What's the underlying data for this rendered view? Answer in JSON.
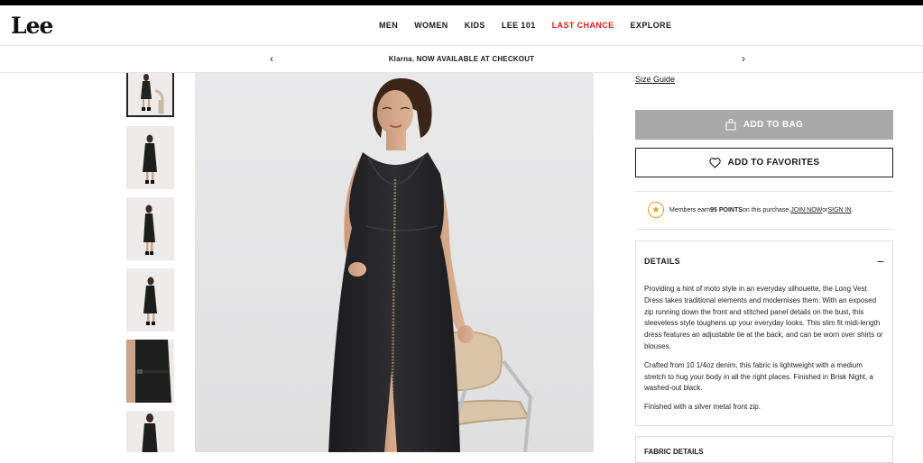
{
  "header": {
    "logo": "Lee",
    "nav": [
      "MEN",
      "WOMEN",
      "KIDS",
      "LEE 101",
      "LAST CHANCE",
      "EXPLORE"
    ],
    "nav_highlight_color": "#d6211f"
  },
  "promo": {
    "brand": "Klarna.",
    "message": " NOW AVAILABLE AT CHECKOUT",
    "prev_icon": "‹",
    "next_icon": "›"
  },
  "gallery": {
    "thumbnail_count": 6,
    "active_index": 0
  },
  "product": {
    "size_guide": "Size Guide",
    "add_to_bag": "ADD TO BAG",
    "add_to_favorites": "ADD TO FAVORITES",
    "members": {
      "prefix": "Members earn ",
      "points": "95 POINTS",
      "middle": " on this purchase. ",
      "join": "JOIN NOW",
      "or": " or ",
      "signin": "SIGN IN",
      "suffix": "."
    },
    "details": {
      "heading": "DETAILS",
      "toggle": "−",
      "paragraphs": [
        "Providing a hint of moto style in an everyday silhouette, the Long Vest Dress takes traditional elements and modernises them. With an exposed zip running down the front and stitched panel details on the bust, this sleeveless style toughens up your everyday looks. This slim fit midi-length dress features an adjustable tie at the back, and can be worn over shirts or blouses.",
        "Crafted from 10 1/4oz denim, this fabric is lightweight with a medium stretch to hug your body in all the right places. Finished in Brisk Night, a washed-out black.",
        "Finished with a silver metal front zip."
      ]
    },
    "next_section": "FABRIC DETAILS"
  },
  "colors": {
    "bag_button_bg": "#a9a9a9",
    "star_color": "#d7a025"
  }
}
